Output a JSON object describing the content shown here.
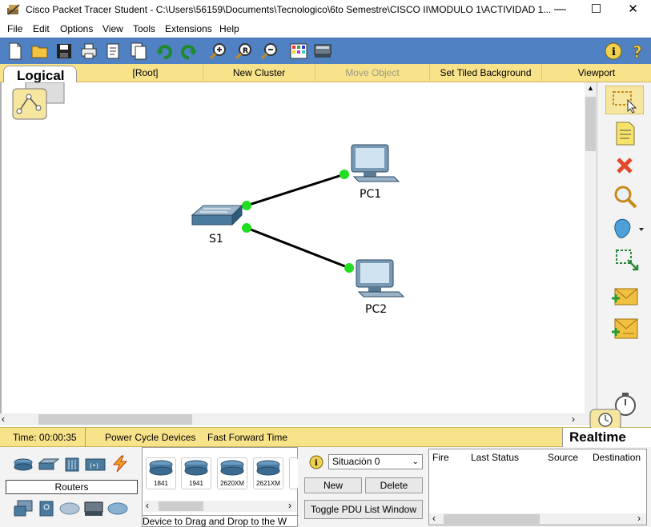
{
  "window": {
    "title": "Cisco Packet Tracer Student - C:\\Users\\56159\\Documents\\Tecnologico\\6to Semestre\\CISCO II\\MODULO 1\\ACTIVIDAD 1...",
    "minimize": "—",
    "maximize": "☐",
    "close": "✕"
  },
  "menu": [
    "File",
    "Edit",
    "Options",
    "View",
    "Tools",
    "Extensions",
    "Help"
  ],
  "toolbar_icons": [
    "new-icon",
    "open-icon",
    "save-icon",
    "print-icon",
    "activity-wizard-icon",
    "copy-icon",
    "undo-icon",
    "redo-icon",
    "zoom-in-icon",
    "zoom-reset-icon",
    "zoom-out-icon",
    "palette-icon",
    "custom-device-icon",
    "info-icon",
    "help-icon"
  ],
  "workspace": {
    "logical_tab": "Logical",
    "root": "[Root]",
    "new_cluster": "New Cluster",
    "move_object": "Move Object",
    "tiled_background": "Set Tiled Background",
    "viewport": "Viewport"
  },
  "topology": {
    "devices": [
      {
        "id": "S1",
        "label": "S1",
        "type": "switch"
      },
      {
        "id": "PC1",
        "label": "PC1",
        "type": "pc"
      },
      {
        "id": "PC2",
        "label": "PC2",
        "type": "pc"
      }
    ],
    "links": [
      {
        "from": "S1",
        "to": "PC1",
        "status": "up"
      },
      {
        "from": "S1",
        "to": "PC2",
        "status": "up"
      }
    ],
    "link_color": "#000000",
    "port_up_color": "#22dd22"
  },
  "right_tools": [
    "select-icon",
    "note-icon",
    "delete-icon",
    "inspect-icon",
    "draw-shape-icon",
    "resize-icon",
    "add-simple-pdu-icon",
    "add-complex-pdu-icon"
  ],
  "status": {
    "time_label": "Time: 00:00:35",
    "power_cycle": "Power Cycle Devices",
    "fast_forward": "Fast Forward Time",
    "mode": "Realtime"
  },
  "device_panel": {
    "category_label": "Routers",
    "models": [
      "1841",
      "1941",
      "2620XM",
      "2621XM"
    ],
    "hint": "Device to Drag and Drop to the W"
  },
  "simulation": {
    "scenario": "Situación 0",
    "new": "New",
    "delete": "Delete",
    "toggle": "Toggle PDU List Window"
  },
  "pdu_table": {
    "columns": [
      "Fire",
      "Last Status",
      "Source",
      "Destination"
    ]
  },
  "colors": {
    "toolbar_blue": "#4f81c3",
    "bar_yellow": "#f8e38a"
  }
}
